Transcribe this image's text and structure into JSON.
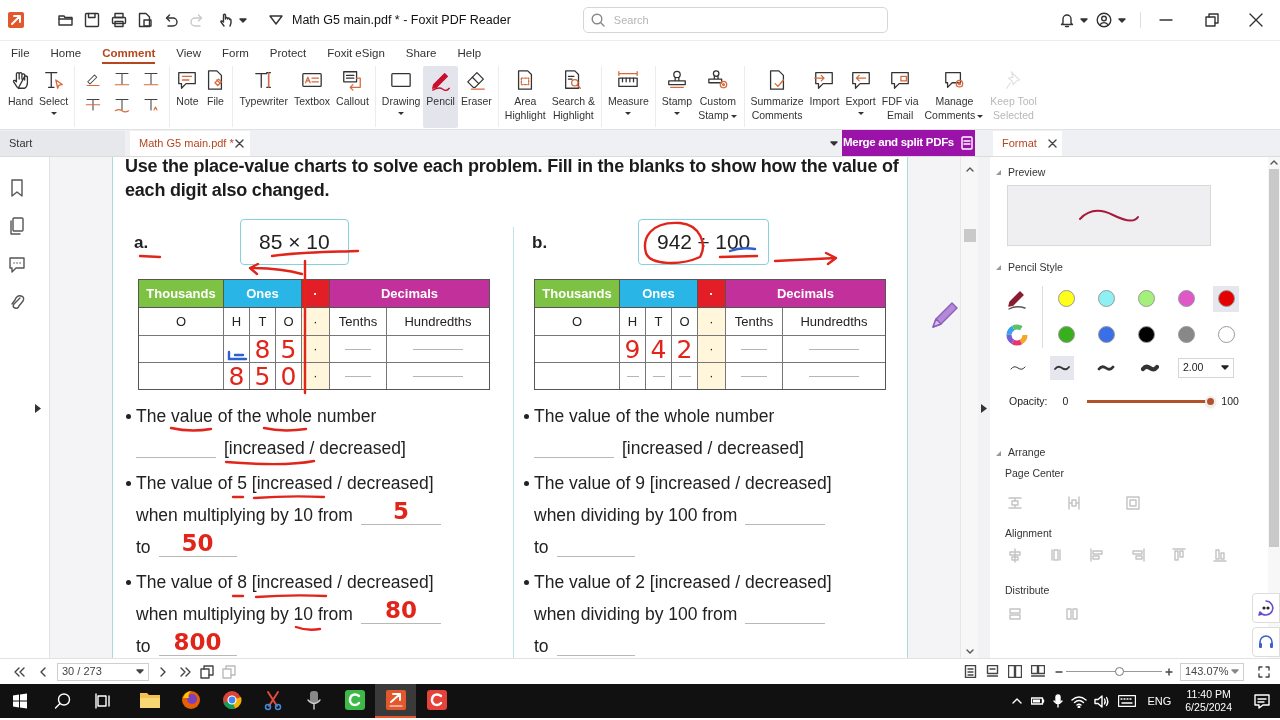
{
  "title_bar": {
    "title": "Math G5 main.pdf * - Foxit PDF Reader",
    "search_placeholder": "Search"
  },
  "menu": [
    {
      "label": "File",
      "selected": false
    },
    {
      "label": "Home",
      "selected": false
    },
    {
      "label": "Comment",
      "selected": true
    },
    {
      "label": "View",
      "selected": false
    },
    {
      "label": "Form",
      "selected": false
    },
    {
      "label": "Protect",
      "selected": false
    },
    {
      "label": "Foxit eSign",
      "selected": false
    },
    {
      "label": "Share",
      "selected": false
    },
    {
      "label": "Help",
      "selected": false
    }
  ],
  "ribbon": [
    {
      "kind": "tools",
      "tools": [
        {
          "label": "Hand",
          "dropdown": false,
          "caret_inline": false,
          "selected": false,
          "disabled": false
        },
        {
          "label": "Select",
          "dropdown": true,
          "caret_inline": false,
          "selected": false,
          "disabled": false
        }
      ]
    },
    {
      "kind": "markup_grid"
    },
    {
      "kind": "tools",
      "tools": [
        {
          "label": "Note",
          "dropdown": false,
          "caret_inline": false,
          "selected": false,
          "disabled": false
        },
        {
          "label": "File",
          "dropdown": false,
          "caret_inline": false,
          "selected": false,
          "disabled": false
        }
      ]
    },
    {
      "kind": "tools",
      "tools": [
        {
          "label": "Typewriter",
          "dropdown": false,
          "caret_inline": false,
          "selected": false,
          "disabled": false
        },
        {
          "label": "Textbox",
          "dropdown": false,
          "caret_inline": false,
          "selected": false,
          "disabled": false
        },
        {
          "label": "Callout",
          "dropdown": false,
          "caret_inline": false,
          "selected": false,
          "disabled": false
        }
      ]
    },
    {
      "kind": "tools",
      "tools": [
        {
          "label": "Drawing",
          "dropdown": true,
          "caret_inline": false,
          "selected": false,
          "disabled": false
        },
        {
          "label": "Pencil",
          "dropdown": false,
          "caret_inline": false,
          "selected": true,
          "disabled": false
        },
        {
          "label": "Eraser",
          "dropdown": false,
          "caret_inline": false,
          "selected": false,
          "disabled": false
        }
      ]
    },
    {
      "kind": "tools",
      "tools": [
        {
          "label": "Area\nHighlight",
          "dropdown": false,
          "caret_inline": false,
          "selected": false,
          "disabled": false
        },
        {
          "label": "Search &\nHighlight",
          "dropdown": false,
          "caret_inline": false,
          "selected": false,
          "disabled": false
        }
      ]
    },
    {
      "kind": "tools",
      "tools": [
        {
          "label": "Measure",
          "dropdown": true,
          "caret_inline": false,
          "selected": false,
          "disabled": false
        }
      ]
    },
    {
      "kind": "tools",
      "tools": [
        {
          "label": "Stamp",
          "dropdown": true,
          "caret_inline": false,
          "selected": false,
          "disabled": false
        },
        {
          "label": "Custom\nStamp",
          "dropdown": true,
          "caret_inline": true,
          "selected": false,
          "disabled": false
        }
      ]
    },
    {
      "kind": "tools",
      "tools": [
        {
          "label": "Summarize\nComments",
          "dropdown": false,
          "caret_inline": false,
          "selected": false,
          "disabled": false
        },
        {
          "label": "Import",
          "dropdown": false,
          "caret_inline": false,
          "selected": false,
          "disabled": false
        },
        {
          "label": "Export",
          "dropdown": true,
          "caret_inline": false,
          "selected": false,
          "disabled": false
        },
        {
          "label": "FDF via\nEmail",
          "dropdown": false,
          "caret_inline": false,
          "selected": false,
          "disabled": false
        },
        {
          "label": "Manage\nComments",
          "dropdown": true,
          "caret_inline": true,
          "selected": false,
          "disabled": false
        },
        {
          "label": "Keep Tool\nSelected",
          "dropdown": false,
          "caret_inline": false,
          "selected": false,
          "disabled": true
        }
      ]
    }
  ],
  "tabs": [
    {
      "label": "Start",
      "selected": false,
      "closable": false
    },
    {
      "label": "Math G5 main.pdf *",
      "selected": true,
      "closable": true
    }
  ],
  "promo_button": "Merge and split PDFs",
  "document": {
    "instruction": "Use the place-value charts to solve each problem. Fill in the blanks to show how the value of each digit also changed.",
    "problems": [
      {
        "letter": "a.",
        "expression": "85 × 10",
        "table": {
          "headers": [
            "Thousands",
            "Ones",
            "·",
            "Decimals"
          ],
          "subheaders": [
            "O",
            "H",
            "T",
            "O",
            "·",
            "Tenths",
            "Hundredths"
          ],
          "rows": [
            [
              {
                "kind": "empty"
              },
              {
                "kind": "ink_mark"
              },
              {
                "kind": "ink",
                "text": "8"
              },
              {
                "kind": "ink",
                "text": "5"
              },
              {
                "kind": "dot",
                "text": "·"
              },
              {
                "kind": "blank"
              },
              {
                "kind": "blank"
              }
            ],
            [
              {
                "kind": "empty"
              },
              {
                "kind": "ink",
                "text": "8"
              },
              {
                "kind": "ink",
                "text": "5"
              },
              {
                "kind": "ink",
                "text": "0"
              },
              {
                "kind": "dot",
                "text": "·"
              },
              {
                "kind": "blank"
              },
              {
                "kind": "blank"
              }
            ]
          ]
        },
        "statements": [
          {
            "kind": "whole",
            "line1": "The value of the whole number",
            "line2": "[increased / decreased]"
          },
          {
            "kind": "digit",
            "line1": "The value of 5 [increased / decreased]",
            "line2": "when multiplying by 10 from",
            "from_ink": "5",
            "line3": "to",
            "to_ink": "50"
          },
          {
            "kind": "digit",
            "line1": "The value of 8 [increased / decreased]",
            "line2": "when multiplying by 10 from",
            "from_ink": "80",
            "line3": "to",
            "to_ink": "800"
          }
        ]
      },
      {
        "letter": "b.",
        "expression": "942 ÷ 100",
        "table": {
          "headers": [
            "Thousands",
            "Ones",
            "·",
            "Decimals"
          ],
          "subheaders": [
            "O",
            "H",
            "T",
            "O",
            "·",
            "Tenths",
            "Hundredths"
          ],
          "rows": [
            [
              {
                "kind": "empty"
              },
              {
                "kind": "ink",
                "text": "9"
              },
              {
                "kind": "ink",
                "text": "4"
              },
              {
                "kind": "ink",
                "text": "2"
              },
              {
                "kind": "dot",
                "text": "·"
              },
              {
                "kind": "blank"
              },
              {
                "kind": "blank"
              }
            ],
            [
              {
                "kind": "empty"
              },
              {
                "kind": "blank"
              },
              {
                "kind": "blank"
              },
              {
                "kind": "blank"
              },
              {
                "kind": "dot",
                "text": "·"
              },
              {
                "kind": "blank"
              },
              {
                "kind": "blank"
              }
            ]
          ]
        },
        "statements": [
          {
            "kind": "whole",
            "line1": "The value of the whole number",
            "line2": "[increased / decreased]"
          },
          {
            "kind": "digit",
            "line1": "The value of 9 [increased / decreased]",
            "line2": "when dividing by 100 from",
            "line3": "to"
          },
          {
            "kind": "digit",
            "line1": "The value of 2 [increased / decreased]",
            "line2": "when dividing by 100 from",
            "line3": "to"
          }
        ]
      }
    ]
  },
  "format_panel": {
    "tab": "Format",
    "preview_heading": "Preview",
    "style_heading": "Pencil Style",
    "colors": [
      {
        "color": "#ffff1a",
        "selected": false
      },
      {
        "color": "#8ef0f5",
        "selected": false
      },
      {
        "color": "#a4f07a",
        "selected": false
      },
      {
        "color": "#e058c8",
        "selected": false
      },
      {
        "color": "#e50000",
        "selected": true
      },
      {
        "color": "#38b01e",
        "selected": false
      },
      {
        "color": "#3a6fe8",
        "selected": false
      },
      {
        "color": "#000000",
        "selected": false
      },
      {
        "color": "#888888",
        "selected": false
      },
      {
        "color": "#ffffff",
        "selected": false
      }
    ],
    "widths": [
      {
        "selected": false
      },
      {
        "selected": true
      },
      {
        "selected": false
      },
      {
        "selected": false
      }
    ],
    "width_value": "2.00",
    "opacity": {
      "label": "Opacity:",
      "min": "0",
      "max": "100",
      "level": 1
    },
    "arrange_heading": "Arrange",
    "page_center_label": "Page Center",
    "alignment_label": "Alignment",
    "distribute_label": "Distribute"
  },
  "status_bar": {
    "page_field": "30 / 273",
    "zoom": {
      "value": "143.07%",
      "level": 0.55
    }
  },
  "taskbar": {
    "apps": [
      {
        "selected": false
      },
      {
        "selected": false
      },
      {
        "selected": false
      },
      {
        "selected": false
      },
      {
        "selected": false
      },
      {
        "selected": false
      },
      {
        "selected": true
      },
      {
        "selected": false
      }
    ],
    "language": "ENG",
    "time": "11:40 PM",
    "date": "6/25/2024"
  }
}
